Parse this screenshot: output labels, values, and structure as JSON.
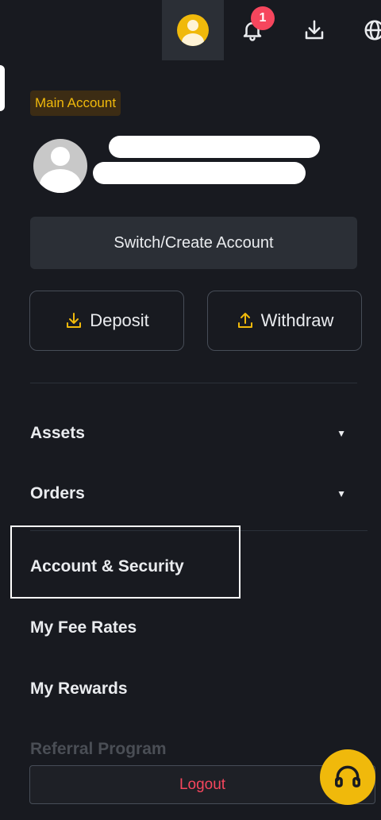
{
  "header": {
    "notification_count": "1",
    "icons": [
      "user-avatar-icon",
      "bell-icon",
      "download-icon",
      "globe-icon"
    ]
  },
  "account": {
    "badge_label": "Main Account",
    "switch_label": "Switch/Create Account",
    "deposit_label": "Deposit",
    "withdraw_label": "Withdraw"
  },
  "menu": {
    "items": [
      {
        "label": "Assets",
        "expandable": true
      },
      {
        "label": "Orders",
        "expandable": true
      },
      {
        "label": "Account & Security",
        "expandable": false
      },
      {
        "label": "My Fee Rates",
        "expandable": false
      },
      {
        "label": "My Rewards",
        "expandable": false
      },
      {
        "label": "Referral Program",
        "expandable": false
      }
    ],
    "caret_glyph": "▼"
  },
  "footer": {
    "logout_label": "Logout"
  },
  "colors": {
    "background": "#181a20",
    "accent": "#f0b90b",
    "danger": "#f6465d",
    "surface": "#2b2f36"
  }
}
